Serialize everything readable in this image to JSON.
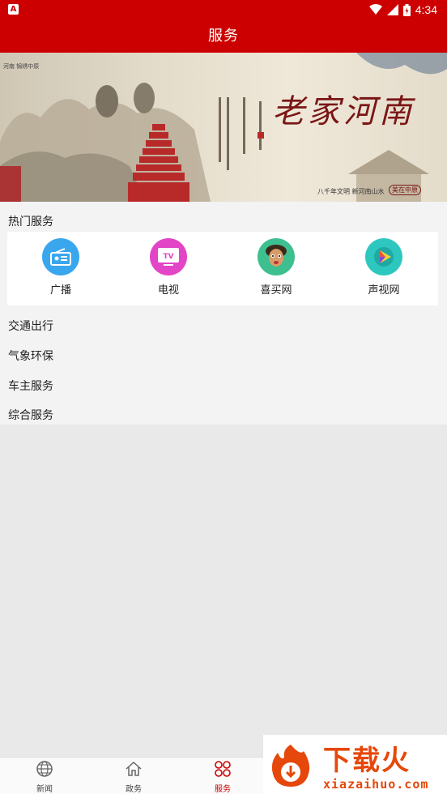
{
  "status_bar": {
    "time": "4:34",
    "notif_icon": "A"
  },
  "header": {
    "title": "服务"
  },
  "banner": {
    "calligraphy": "老家河南",
    "subtitle": "八千年文明 新河南山水",
    "stamp": "美在中原",
    "corner_text": "河南 锦绣中原"
  },
  "hot_services": {
    "title": "热门服务",
    "items": [
      {
        "label": "广播",
        "icon": "radio-icon",
        "color": "#3aa6ee"
      },
      {
        "label": "电视",
        "icon": "tv-icon",
        "color": "#e245c6"
      },
      {
        "label": "喜买网",
        "icon": "mascot-icon",
        "color": "#3dbf8f"
      },
      {
        "label": "声视网",
        "icon": "play-icon",
        "color": "#2ec7c0"
      }
    ]
  },
  "sections": [
    "交通出行",
    "气象环保",
    "车主服务",
    "综合服务"
  ],
  "bottom_nav": {
    "items": [
      {
        "label": "新闻",
        "icon": "globe-icon"
      },
      {
        "label": "政务",
        "icon": "home-icon"
      },
      {
        "label": "服务",
        "icon": "services-icon",
        "active": true
      }
    ]
  },
  "watermark": {
    "text": "下载火",
    "url": "xiazaihuo.com"
  },
  "colors": {
    "brand_red": "#cc0000",
    "watermark_orange": "#e5480a"
  }
}
